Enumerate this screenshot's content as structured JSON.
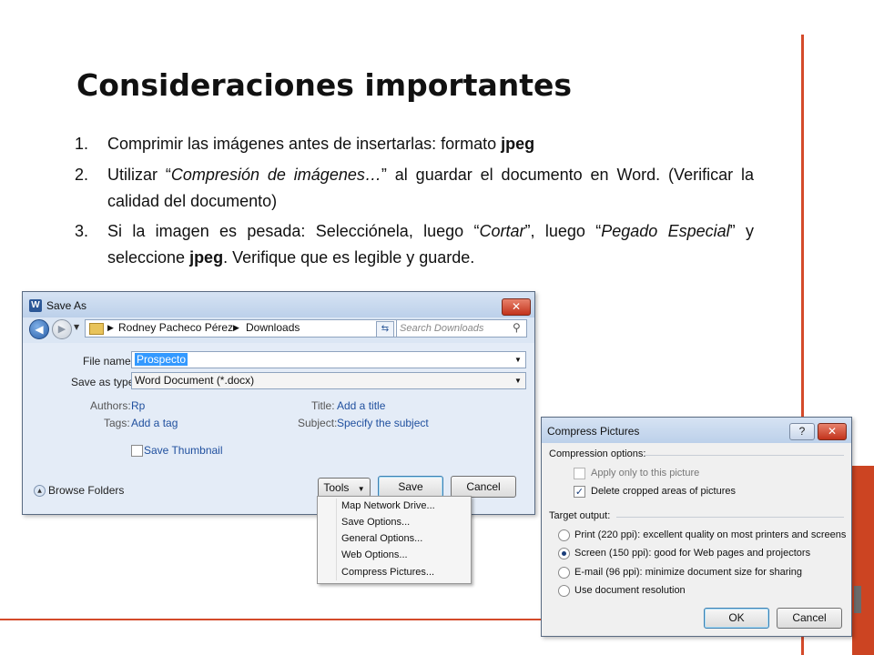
{
  "slide": {
    "title": "Consideraciones importantes",
    "items": [
      {
        "num": "1.",
        "parts": [
          "Comprimir las imágenes antes de insertarlas: formato ",
          "jpeg"
        ]
      },
      {
        "num": "2.",
        "parts": [
          "Utilizar “",
          "Compresión de imágenes…",
          "” al guardar el documento en Word. (Verificar la calidad del documento)"
        ]
      },
      {
        "num": "3.",
        "parts": [
          "Si la imagen es pesada: Selecciónela, luego “",
          "Cortar",
          "”, luego “",
          "Pegado Especial",
          "” y seleccione ",
          "jpeg",
          ". Verifique que es legible y guarde."
        ]
      }
    ]
  },
  "save_as": {
    "title": "Save As",
    "breadcrumb": [
      "Rodney Pacheco Pérez",
      "Downloads"
    ],
    "search_placeholder": "Search Downloads",
    "file_name_label": "File name:",
    "file_name_value": "Prospecto",
    "save_type_label": "Save as type:",
    "save_type_value": "Word Document (*.docx)",
    "authors_label": "Authors:",
    "authors_value": "Rp",
    "tags_label": "Tags:",
    "tags_value": "Add a tag",
    "title_label": "Title:",
    "title_value": "Add a title",
    "subject_label": "Subject:",
    "subject_value": "Specify the subject",
    "save_thumbnail": "Save Thumbnail",
    "browse_folders": "Browse Folders",
    "tools": "Tools",
    "save": "Save",
    "cancel": "Cancel",
    "tools_menu": [
      "Map Network Drive...",
      "Save Options...",
      "General Options...",
      "Web Options...",
      "Compress Pictures..."
    ]
  },
  "compress": {
    "title": "Compress Pictures",
    "help": "?",
    "compression_options": "Compression options:",
    "apply_only": "Apply only to this picture",
    "apply_only_checked": false,
    "delete_cropped": "Delete cropped areas of pictures",
    "delete_cropped_checked": true,
    "target_output": "Target output:",
    "options": [
      "Print (220 ppi): excellent quality on most printers and screens",
      "Screen (150 ppi): good for Web pages and projectors",
      "E-mail (96 ppi): minimize document size for sharing",
      "Use document resolution"
    ],
    "selected_index": 1,
    "ok": "OK",
    "cancel": "Cancel"
  },
  "colors": {
    "accent": "#d44a2a",
    "link": "#1f4f9e"
  }
}
